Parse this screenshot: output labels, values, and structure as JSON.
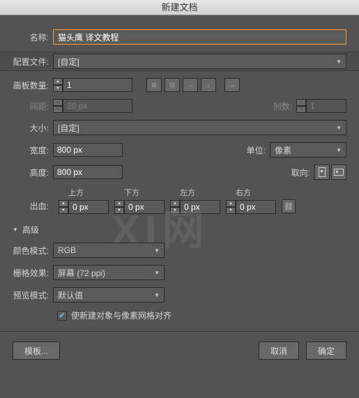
{
  "title": "新建文档",
  "name": {
    "label": "名称:",
    "value": "猫头鹰 译文教程"
  },
  "profile": {
    "label": "配置文件:",
    "value": "[自定]"
  },
  "artboards": {
    "label": "画板数量:",
    "value": "1"
  },
  "spacing": {
    "label": "间距:",
    "value": "20 px"
  },
  "columns": {
    "label": "列数:",
    "value": "1"
  },
  "size": {
    "label": "大小:",
    "value": "[自定]"
  },
  "width": {
    "label": "宽度:",
    "value": "800 px"
  },
  "height": {
    "label": "高度:",
    "value": "800 px"
  },
  "unit": {
    "label": "单位:",
    "value": "像素"
  },
  "orientation": {
    "label": "取向:"
  },
  "bleed": {
    "label": "出血:",
    "top": {
      "label": "上方",
      "value": "0 px"
    },
    "bottom": {
      "label": "下方",
      "value": "0 px"
    },
    "left": {
      "label": "左方",
      "value": "0 px"
    },
    "right": {
      "label": "右方",
      "value": "0 px"
    }
  },
  "advanced": {
    "label": "高级",
    "colormode": {
      "label": "颜色模式:",
      "value": "RGB"
    },
    "raster": {
      "label": "栅格效果:",
      "value": "屏幕 (72 ppi)"
    },
    "preview": {
      "label": "预览模式:",
      "value": "默认值"
    },
    "align": {
      "label": "使新建对象与像素网格对齐",
      "checked": true
    }
  },
  "buttons": {
    "template": "模板...",
    "cancel": "取消",
    "ok": "确定"
  }
}
